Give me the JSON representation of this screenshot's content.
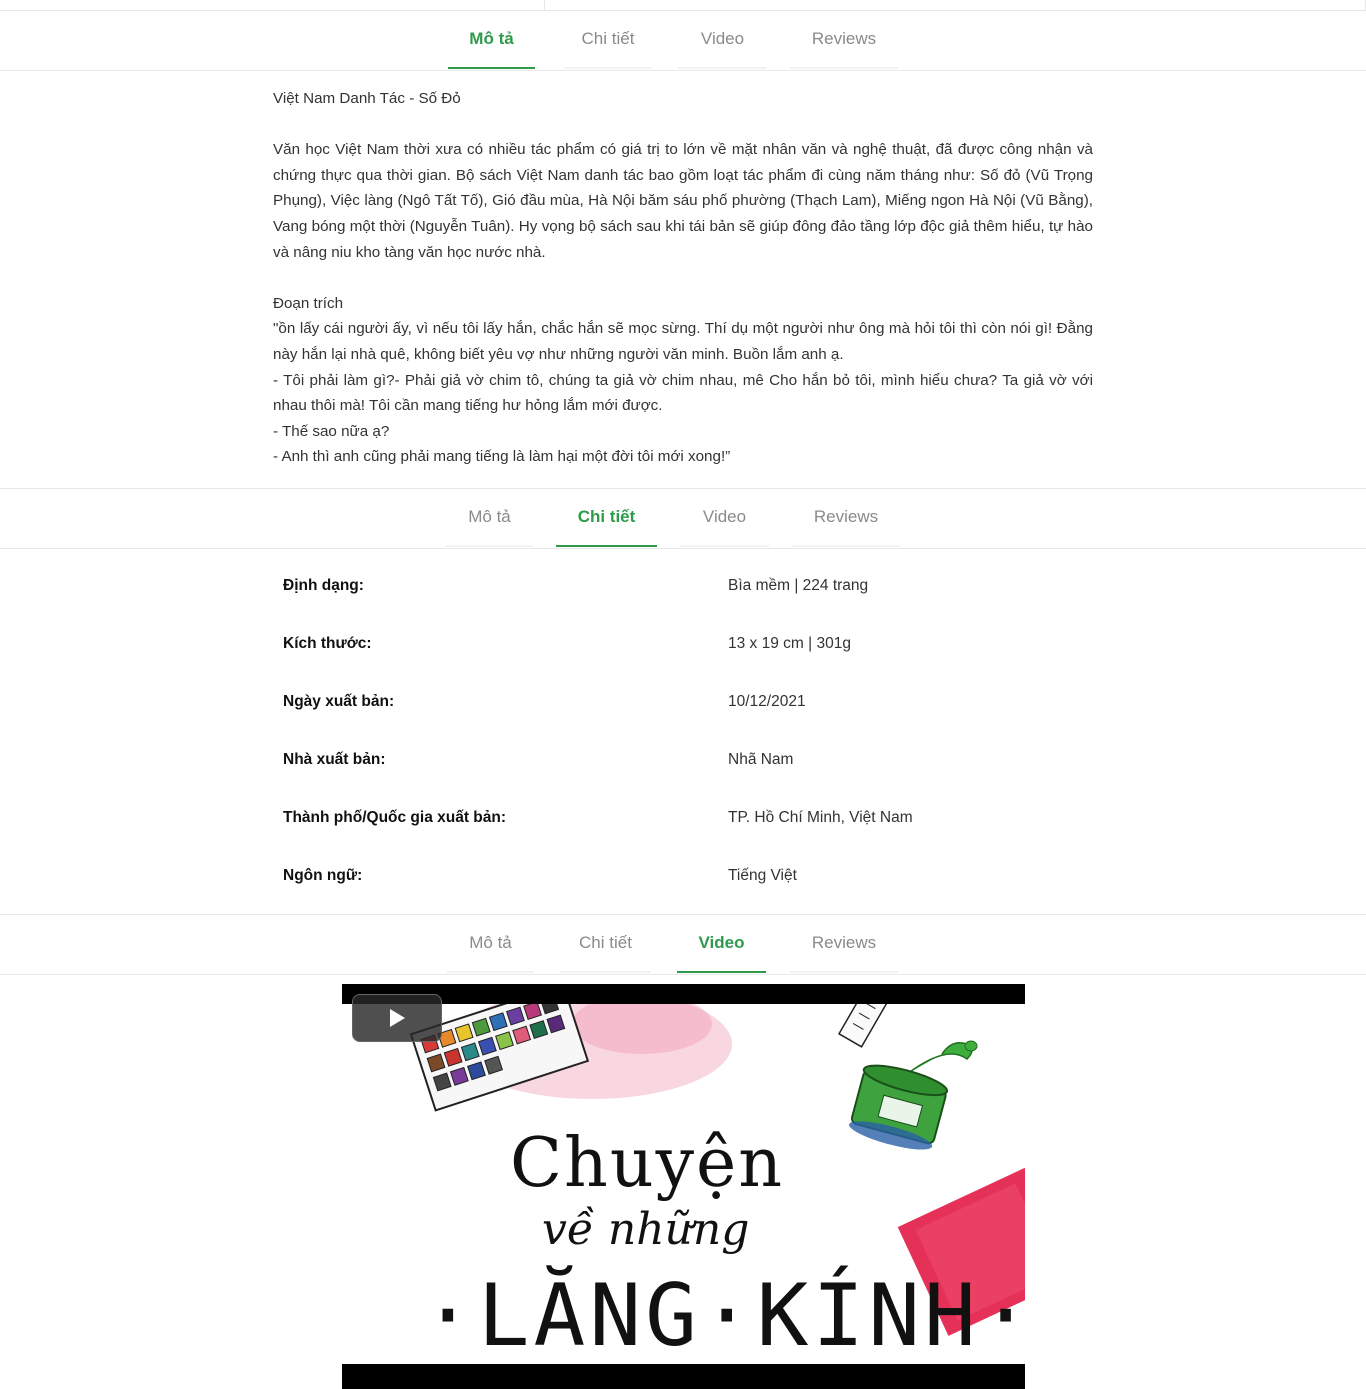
{
  "tabs": {
    "labels": [
      "Mô tả",
      "Chi tiết",
      "Video",
      "Reviews"
    ]
  },
  "description": {
    "title": "Việt Nam Danh Tác - Số Đỏ",
    "paragraph": "Văn học Việt Nam thời xưa có nhiều tác phẩm có giá trị to lớn về mặt nhân văn và nghệ thuật, đã được công nhận và chứng thực qua thời gian. Bộ sách Việt Nam danh tác bao gồm loạt tác phẩm đi cùng năm tháng như: Số đỏ (Vũ Trọng Phụng), Việc làng (Ngô Tất Tố), Gió đầu mùa, Hà Nội băm sáu phố phường (Thạch Lam), Miếng ngon Hà Nội (Vũ Bằng), Vang bóng một thời (Nguyễn Tuân). Hy vọng bộ sách sau khi tái bản sẽ giúp đông đảo tầng lớp độc giả thêm hiểu, tự hào và nâng niu kho tàng văn học nước nhà.",
    "excerpt_heading": "Đoạn trích",
    "excerpt_1": "\"ồn lấy cái người ấy, vì nếu tôi lấy hắn, chắc hắn sẽ mọc sừng. Thí dụ một người như ông mà hỏi tôi thì còn nói gì! Đằng này hắn lại nhà quê, không biết yêu vợ như những người văn minh. Buồn lắm anh ạ.",
    "excerpt_2": "- Tôi phải làm gì?- Phải giả vờ chim tô, chúng ta giả vờ chim nhau, mê Cho hắn bỏ tôi, mình hiểu chưa? Ta giả vờ với nhau thôi mà! Tôi cần mang tiếng hư hỏng lắm mới được.",
    "excerpt_3": "- Thế sao nữa ạ?",
    "excerpt_4": "- Anh thì anh cũng phải mang tiếng là làm hại một đời tôi mới xong!”"
  },
  "details": [
    {
      "label": "Định dạng:",
      "value": "Bìa mềm | 224 trang"
    },
    {
      "label": "Kích thước:",
      "value": "13 x 19 cm | 301g"
    },
    {
      "label": "Ngày xuất bản:",
      "value": "10/12/2021"
    },
    {
      "label": "Nhà xuất bản:",
      "value": "Nhã Nam"
    },
    {
      "label": "Thành phố/Quốc gia xuất bản:",
      "value": "TP. Hồ Chí Minh, Việt Nam"
    },
    {
      "label": "Ngôn ngữ:",
      "value": "Tiếng Việt"
    }
  ],
  "video": {
    "title_line1": "Chuyện",
    "title_line2": "về những",
    "title_line3": "·LĂNG·KÍNH·",
    "play_icon": "play-icon"
  },
  "colors": {
    "accent": "#2e9b4b",
    "tab_inactive": "#8a8a8a"
  }
}
